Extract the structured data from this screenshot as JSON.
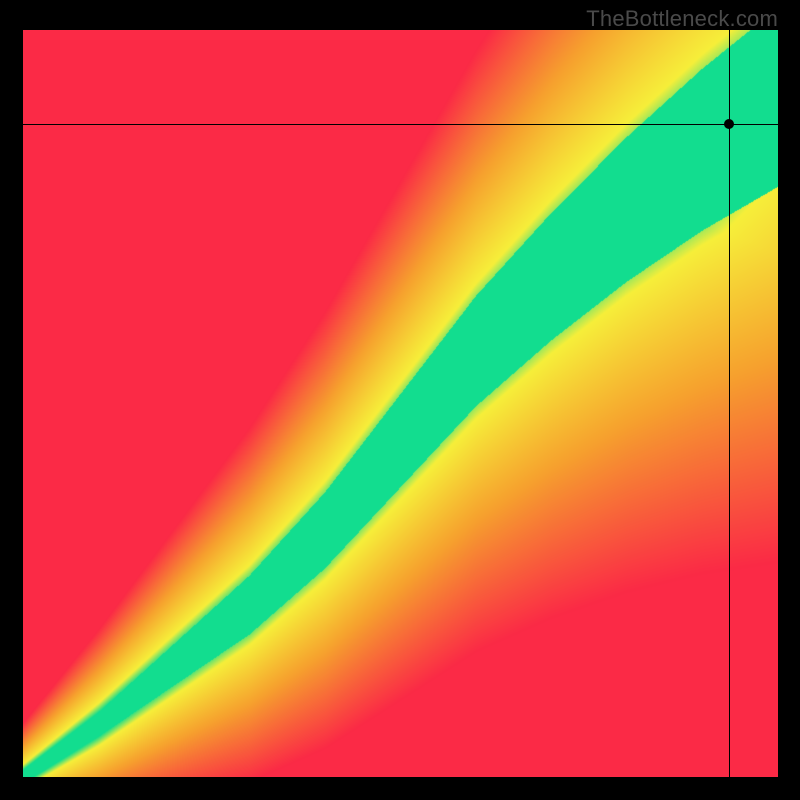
{
  "watermark": "TheBottleneck.com",
  "chart_data": {
    "type": "heatmap",
    "title": "",
    "xlabel": "",
    "ylabel": "",
    "xlim": [
      0,
      1
    ],
    "ylim": [
      0,
      1
    ],
    "ridge": [
      {
        "x": 0.0,
        "y": 0.0
      },
      {
        "x": 0.1,
        "y": 0.07
      },
      {
        "x": 0.2,
        "y": 0.15
      },
      {
        "x": 0.3,
        "y": 0.23
      },
      {
        "x": 0.4,
        "y": 0.33
      },
      {
        "x": 0.5,
        "y": 0.45
      },
      {
        "x": 0.6,
        "y": 0.57
      },
      {
        "x": 0.7,
        "y": 0.67
      },
      {
        "x": 0.8,
        "y": 0.76
      },
      {
        "x": 0.9,
        "y": 0.84
      },
      {
        "x": 1.0,
        "y": 0.91
      }
    ],
    "band_start_width": 0.005,
    "band_end_width": 0.12,
    "crosshair": {
      "x": 0.935,
      "y": 0.874
    },
    "marker": {
      "x": 0.935,
      "y": 0.874
    },
    "color_stops": {
      "ridge": "#12dd8f",
      "near": "#f7ef3a",
      "mid": "#f6a12e",
      "far": "#fb2a46"
    }
  }
}
